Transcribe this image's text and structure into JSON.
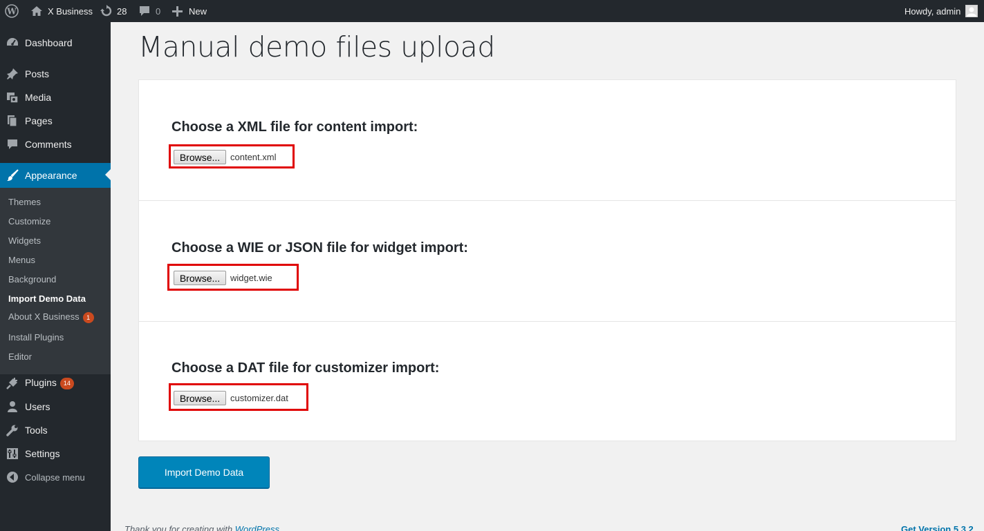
{
  "adminbar": {
    "site_name": "X Business",
    "updates_count": "28",
    "comments_count": "0",
    "new_label": "New",
    "greeting": "Howdy, admin"
  },
  "sidebar": {
    "menu": [
      {
        "label": "Dashboard",
        "icon": "dashboard-icon"
      },
      {
        "label": "Posts",
        "icon": "pin-icon"
      },
      {
        "label": "Media",
        "icon": "media-icon"
      },
      {
        "label": "Pages",
        "icon": "pages-icon"
      },
      {
        "label": "Comments",
        "icon": "comment-icon"
      },
      {
        "label": "Appearance",
        "icon": "paintbrush-icon"
      }
    ],
    "submenu": [
      {
        "label": "Themes"
      },
      {
        "label": "Customize"
      },
      {
        "label": "Widgets"
      },
      {
        "label": "Menus"
      },
      {
        "label": "Background"
      },
      {
        "label": "Import Demo Data"
      },
      {
        "label": "About X Business",
        "badge": "1"
      },
      {
        "label": "Install Plugins"
      },
      {
        "label": "Editor"
      }
    ],
    "menu_after": [
      {
        "label": "Plugins",
        "icon": "plugin-icon",
        "badge": "14"
      },
      {
        "label": "Users",
        "icon": "users-icon"
      },
      {
        "label": "Tools",
        "icon": "wrench-icon"
      },
      {
        "label": "Settings",
        "icon": "settings-icon"
      }
    ],
    "collapse_label": "Collapse menu"
  },
  "main": {
    "title": "Manual demo files upload",
    "sections": [
      {
        "heading": "Choose a XML file for content import:",
        "browse_label": "Browse...",
        "file_name": "content.xml"
      },
      {
        "heading": "Choose a WIE or JSON file for widget import:",
        "browse_label": "Browse...",
        "file_name": "widget.wie"
      },
      {
        "heading": "Choose a DAT file for customizer import:",
        "browse_label": "Browse...",
        "file_name": "customizer.dat"
      }
    ],
    "import_button": "Import Demo Data"
  },
  "footer": {
    "thanks_prefix": "Thank you for creating with ",
    "thanks_link": "WordPress",
    "version_link": "Get Version 5.3.2"
  },
  "colors": {
    "adminbar_bg": "#23282d",
    "sidebar_bg": "#23282d",
    "submenu_bg": "#32373c",
    "current_menu_bg": "#0073aa",
    "primary_button": "#0085ba",
    "highlight_border": "#e00000",
    "badge": "#ca4a1f"
  }
}
